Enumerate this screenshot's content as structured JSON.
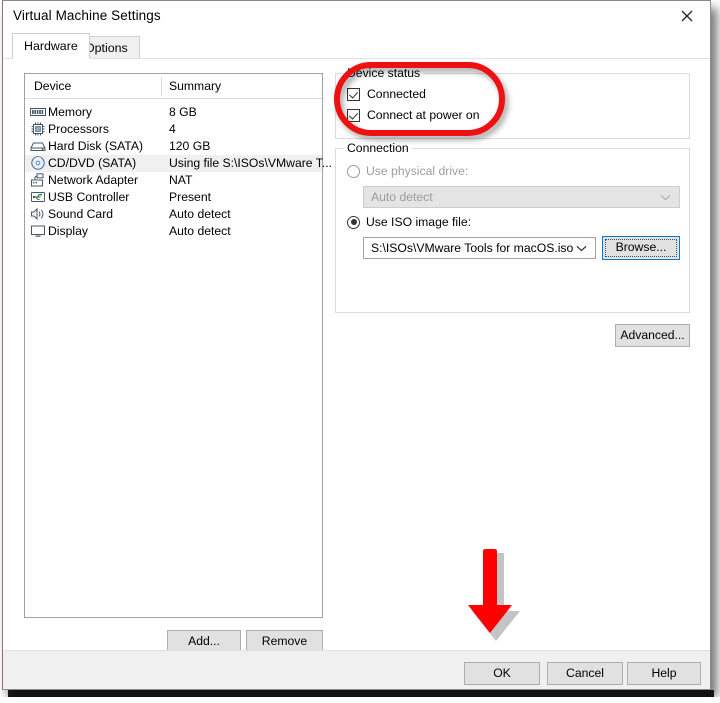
{
  "window": {
    "title": "Virtual Machine Settings",
    "close_icon": "close-icon"
  },
  "tabs": [
    {
      "label": "Hardware",
      "active": true
    },
    {
      "label": "Options",
      "active": false
    }
  ],
  "device_list": {
    "columns": [
      "Device",
      "Summary"
    ],
    "rows": [
      {
        "icon": "memory-icon",
        "name": "Memory",
        "summary": "8 GB",
        "selected": false
      },
      {
        "icon": "processor-icon",
        "name": "Processors",
        "summary": "4",
        "selected": false
      },
      {
        "icon": "hard-disk-icon",
        "name": "Hard Disk (SATA)",
        "summary": "120 GB",
        "selected": false
      },
      {
        "icon": "cd-dvd-icon",
        "name": "CD/DVD (SATA)",
        "summary": "Using file S:\\ISOs\\VMware T...",
        "selected": true
      },
      {
        "icon": "network-adapter-icon",
        "name": "Network Adapter",
        "summary": "NAT",
        "selected": false
      },
      {
        "icon": "usb-controller-icon",
        "name": "USB Controller",
        "summary": "Present",
        "selected": false
      },
      {
        "icon": "sound-card-icon",
        "name": "Sound Card",
        "summary": "Auto detect",
        "selected": false
      },
      {
        "icon": "display-icon",
        "name": "Display",
        "summary": "Auto detect",
        "selected": false
      }
    ]
  },
  "list_buttons": {
    "add": "Add...",
    "remove": "Remove"
  },
  "device_status": {
    "group_title": "Device status",
    "connected": {
      "label": "Connected",
      "checked": true
    },
    "connect_at_power_on": {
      "label": "Connect at power on",
      "checked": true
    }
  },
  "connection": {
    "group_title": "Connection",
    "use_physical_drive": {
      "label": "Use physical drive:",
      "selected": false,
      "disabled": true
    },
    "physical_drive_combo": {
      "value": "Auto detect",
      "disabled": true
    },
    "use_iso_image_file": {
      "label": "Use ISO image file:",
      "selected": true,
      "disabled": false
    },
    "iso_combo": {
      "value": "S:\\ISOs\\VMware Tools for macOS.iso",
      "disabled": false
    },
    "browse_button": "Browse...",
    "advanced_button": "Advanced..."
  },
  "footer": {
    "ok": "OK",
    "cancel": "Cancel",
    "help": "Help"
  },
  "annotations": {
    "highlight_color": "#ee1111",
    "arrow_color": "#ff0000",
    "highlight_target": "Device status group",
    "arrow_target": "OK button"
  }
}
